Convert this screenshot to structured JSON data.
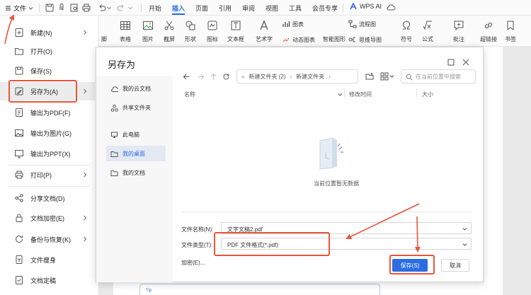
{
  "app": {
    "file_menu_label": "文件",
    "menu_tabs": [
      "开始",
      "插入",
      "页面",
      "引用",
      "审阅",
      "视图",
      "工具",
      "会员专享"
    ],
    "active_tab": "插入",
    "wps_ai_label": "WPS AI",
    "accent_color": "#2b6de1",
    "annotation_color": "#e8553c"
  },
  "quick_access_icons": [
    "save-icon",
    "pdf-export-icon",
    "print-preview-icon",
    "print-icon",
    "undo-icon",
    "dropdown-icon",
    "redo-icon",
    "dropdown-icon"
  ],
  "ribbon": {
    "partial_label": "脚",
    "large_buttons": [
      "表格",
      "图片",
      "截屏",
      "形状",
      "图标",
      "文本框",
      "艺术字",
      "符号",
      "公式",
      "批注",
      "超链接",
      "书签"
    ],
    "small_buttons": [
      "图表",
      "动态图表",
      "智能图形",
      "流程图",
      "思维导图"
    ]
  },
  "file_panel": {
    "items": [
      {
        "label": "新建(N)",
        "icon": "new-icon",
        "has_arrow": true
      },
      {
        "label": "打开(O)",
        "icon": "open-folder-icon",
        "has_arrow": false
      },
      {
        "label": "保存(S)",
        "icon": "save-icon",
        "has_arrow": false
      },
      {
        "label": "另存为(A)",
        "icon": "save-as-icon",
        "has_arrow": true,
        "selected": true
      },
      {
        "label": "输出为PDF(F)",
        "icon": "pdf-icon",
        "has_arrow": false
      },
      {
        "label": "输出为图片(G)",
        "icon": "image-icon",
        "has_arrow": false
      },
      {
        "label": "输出为PPT(X)",
        "icon": "ppt-icon",
        "has_arrow": false
      },
      {
        "label": "打印(P)",
        "icon": "print-icon",
        "has_arrow": true
      },
      {
        "label": "分享文档(D)",
        "icon": "share-icon",
        "has_arrow": false
      },
      {
        "label": "文档加密(E)",
        "icon": "lock-icon",
        "has_arrow": true
      },
      {
        "label": "备份与恢复(K)",
        "icon": "backup-icon",
        "has_arrow": true
      },
      {
        "label": "文件瘦身",
        "icon": "slim-icon",
        "has_arrow": false
      },
      {
        "label": "文档定稿",
        "icon": "finalize-icon",
        "has_arrow": false
      }
    ]
  },
  "dialog": {
    "title": "另存为",
    "sidebar": [
      {
        "label": "我的云文档",
        "icon": "cloud-icon"
      },
      {
        "label": "共享文件夹",
        "icon": "share-folder-icon"
      },
      {
        "label": "此电脑",
        "icon": "computer-icon"
      },
      {
        "label": "我的桌面",
        "icon": "folder-icon",
        "selected": true
      },
      {
        "label": "我的文档",
        "icon": "folder-icon"
      }
    ],
    "breadcrumb": [
      "新建文件夹 (2)",
      "新建文件夹"
    ],
    "search_placeholder": "在当前位置中搜索",
    "columns": [
      "名称",
      "修改时间",
      "大小"
    ],
    "empty_text": "当前位置暂无数据",
    "filename_label": "文件名称(N):",
    "filename_value": "文字文稿2.pdf",
    "filetype_label": "文件类型(T):",
    "filetype_value": "PDF 文件格式(*.pdf)",
    "encrypt_label": "加密(E)...",
    "save_label": "保存(S)",
    "cancel_label": "取消"
  },
  "tip_label": "Tip"
}
